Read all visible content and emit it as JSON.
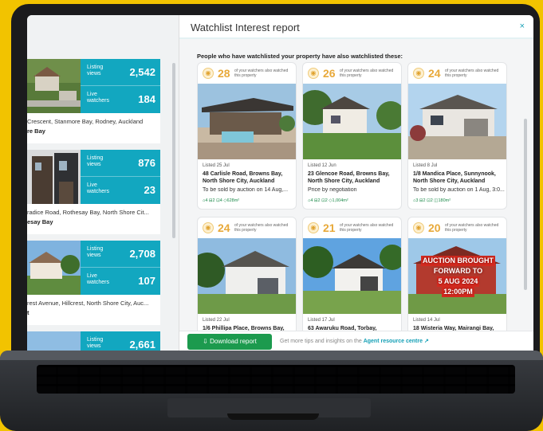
{
  "left_list": {
    "cards": [
      {
        "views_label": "Listing views",
        "views": "2,542",
        "watch_label": "Live watchers",
        "watchers": "184",
        "address": "Crescent, Stanmore Bay, Rodney, Auckland",
        "suburb": "re Bay"
      },
      {
        "views_label": "Listing views",
        "views": "876",
        "watch_label": "Live watchers",
        "watchers": "23",
        "address": "radice Road, Rothesay Bay, North Shore Cit...",
        "suburb": "esay Bay"
      },
      {
        "views_label": "Listing views",
        "views": "2,708",
        "watch_label": "Live watchers",
        "watchers": "107",
        "address": "rest Avenue, Hillcrest, North Shore City, Auc...",
        "suburb": "t"
      },
      {
        "views_label": "Listing views",
        "views": "2,661",
        "watch_label": "",
        "watchers": "",
        "address": "",
        "suburb": ""
      }
    ]
  },
  "modal": {
    "title": "Watchlist Interest report",
    "close_icon": "×",
    "heading": "People who have watchlisted your property have also watchlisted these:",
    "watch_text": "of your watchers also watched this property",
    "properties": [
      {
        "count": "28",
        "listed": "Listed 25 Jul",
        "address": "48 Carlisle Road, Browns Bay, North Shore City, Auckland",
        "sale": "To be sold by auction on 14 Aug,...",
        "features": "⌂4 ⊟2 ⊡4 ◇628m²"
      },
      {
        "count": "26",
        "listed": "Listed 12 Jun",
        "address": "23 Glencoe Road, Browns Bay, North Shore City, Auckland",
        "sale": "Price by negotiation",
        "features": "⌂4 ⊟2 ⊡2 ◇1,004m²"
      },
      {
        "count": "24",
        "listed": "Listed 8 Jul",
        "address": "1/8 Mandica Place, Sunnynook, North Shore City, Auckland",
        "sale": "To be sold by auction on 1 Aug, 3:0...",
        "features": "⌂3 ⊟2 ⊡2 ◫180m²"
      },
      {
        "count": "24",
        "listed": "Listed 22 Jul",
        "address": "1/6 Phillipa Place, Browns Bay,",
        "sale": "",
        "features": ""
      },
      {
        "count": "21",
        "listed": "Listed 17 Jul",
        "address": "63 Awaruku Road, Torbay,",
        "sale": "",
        "features": ""
      },
      {
        "count": "20",
        "listed": "Listed 14 Jul",
        "address": "18 Wisteria Way, Mairangi Bay,",
        "sale": "",
        "features": ""
      }
    ],
    "auction_banner": {
      "line1": "AUCTION BROUGHT",
      "line2": "FORWARD TO",
      "line3": "5 AUG 2024",
      "line4": "12:00PM"
    },
    "footer": {
      "download_label": "Download report",
      "tip_prefix": "Get more tips and insights on the",
      "tip_link": "Agent resource centre"
    }
  },
  "colors": {
    "teal": "#12a7c0",
    "green": "#1c9a4e",
    "gold": "#e8a93a",
    "background": "#f2c300"
  }
}
